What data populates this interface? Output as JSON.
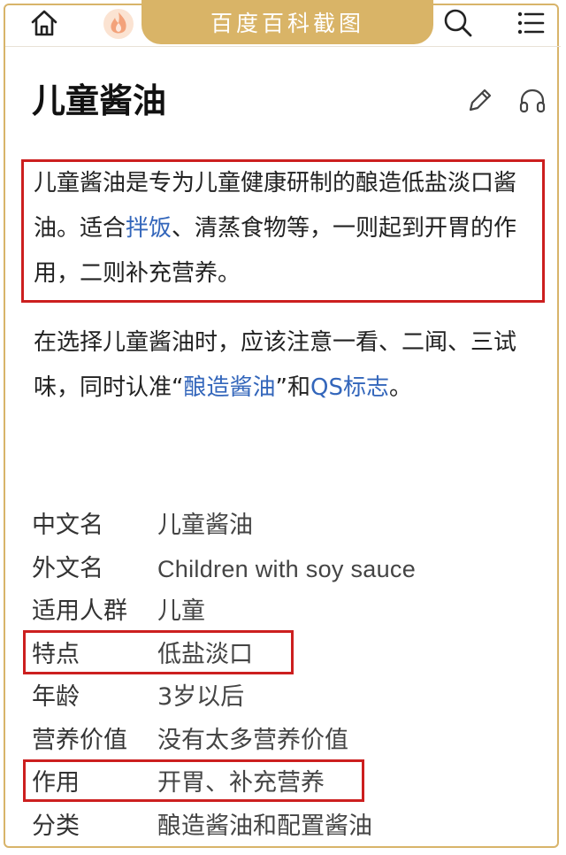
{
  "header": {
    "banner_text": "百度百科截图",
    "icons": [
      "home-icon",
      "fire-icon",
      "search-icon",
      "menu-icon"
    ],
    "accent_color": "#d9b467"
  },
  "article": {
    "title": "儿童酱油",
    "actions": [
      "edit-icon",
      "headphones-icon"
    ],
    "para1": {
      "t1": "儿童酱油是专为儿童健康研制的酿造低盐淡口酱油。适合",
      "link1": "拌饭",
      "t2": "、清蒸食物等，一则起到开胃的作用，二则补充营养。"
    },
    "para2": {
      "t1": "在选择儿童酱油时，应该注意一看、二闻、三试味，同时认准“",
      "link1": "酿造酱油",
      "t2": "”和",
      "link2": "QS标志",
      "t3": "。"
    },
    "link_color": "#3366bb",
    "highlight_color": "#cc1f1f"
  },
  "infobox": [
    {
      "key": "中文名",
      "value": "儿童酱油"
    },
    {
      "key": "外文名",
      "value": "Children with soy sauce"
    },
    {
      "key": "适用人群",
      "value": "儿童"
    },
    {
      "key": "特点",
      "value": "低盐淡口"
    },
    {
      "key": "年龄",
      "value": "3岁以后"
    },
    {
      "key": "营养价值",
      "value": "没有太多营养价值"
    },
    {
      "key": "作用",
      "value": "开胃、补充营养"
    },
    {
      "key": "分类",
      "value": "酿造酱油和配置酱油"
    }
  ]
}
